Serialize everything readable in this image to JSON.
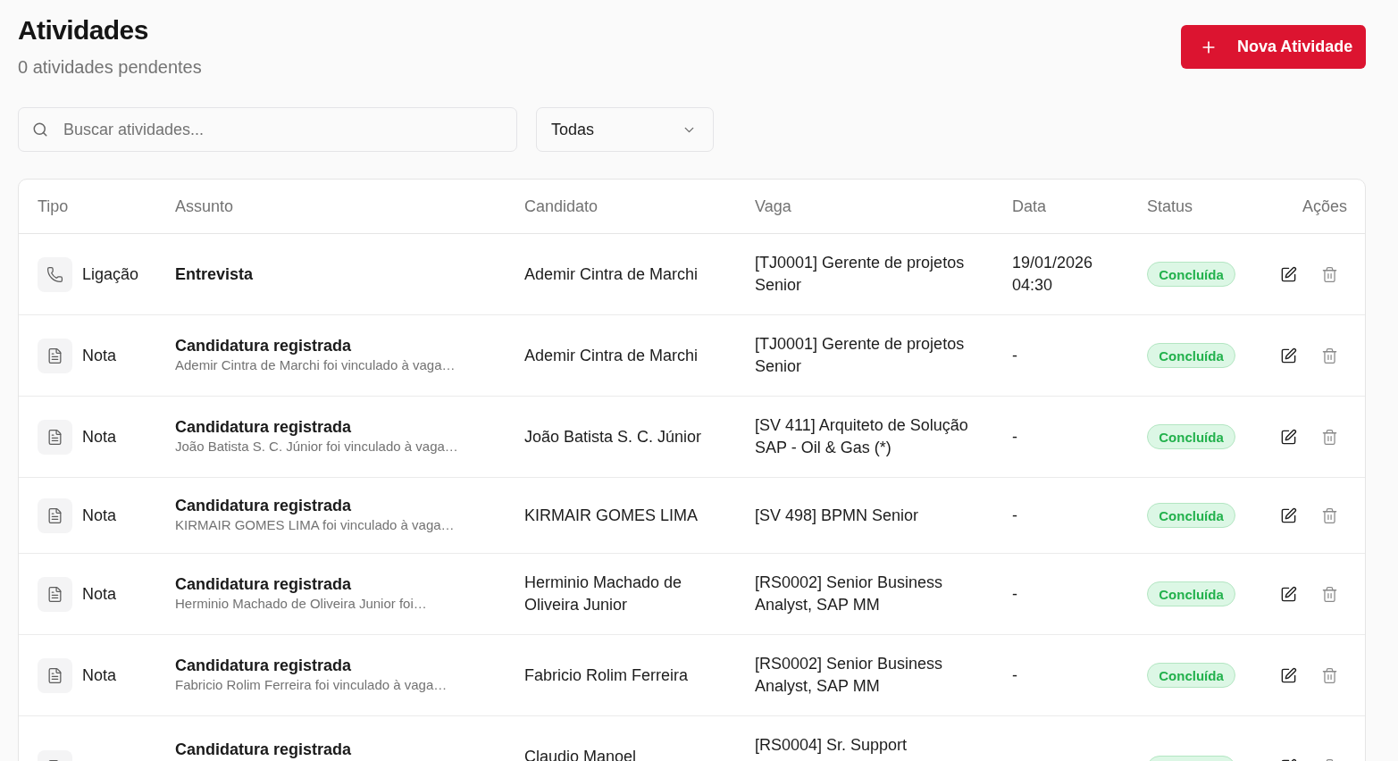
{
  "page": {
    "title": "Atividades",
    "subtitle": "0 atividades pendentes"
  },
  "new_button": {
    "label": "Nova Atividade"
  },
  "search": {
    "placeholder": "Buscar atividades..."
  },
  "filter": {
    "value": "Todas"
  },
  "table": {
    "columns": [
      "Tipo",
      "Assunto",
      "Candidato",
      "Vaga",
      "Data",
      "Status",
      "Ações"
    ],
    "rows": [
      {
        "type": {
          "kind": "call",
          "label": "Ligação"
        },
        "subject": "Entrevista",
        "candidate": "Ademir Cintra de Marchi",
        "job": "[TJ0001] Gerente de projetos Senior",
        "date": "19/01/2026 04:30",
        "status": {
          "kind": "done",
          "label": "Concluída"
        }
      },
      {
        "type": {
          "kind": "note",
          "label": "Nota"
        },
        "subject": "Candidatura registrada",
        "detail": "Ademir Cintra de Marchi foi vinculado à vaga…",
        "candidate": "Ademir Cintra de Marchi",
        "job": "[TJ0001] Gerente de projetos Senior",
        "date": "-",
        "status": {
          "kind": "done",
          "label": "Concluída"
        }
      },
      {
        "type": {
          "kind": "note",
          "label": "Nota"
        },
        "subject": "Candidatura registrada",
        "detail": "João Batista S. C. Júnior foi vinculado à vaga…",
        "candidate": "João Batista S. C. Júnior",
        "job": "[SV 411] Arquiteto de Solução SAP - Oil & Gas (*)",
        "date": "-",
        "status": {
          "kind": "done",
          "label": "Concluída"
        }
      },
      {
        "type": {
          "kind": "note",
          "label": "Nota"
        },
        "subject": "Candidatura registrada",
        "detail": "KIRMAIR GOMES LIMA foi vinculado à vaga…",
        "candidate": "KIRMAIR GOMES LIMA",
        "job": "[SV 498] BPMN Senior",
        "date": "-",
        "status": {
          "kind": "done",
          "label": "Concluída"
        }
      },
      {
        "type": {
          "kind": "note",
          "label": "Nota"
        },
        "subject": "Candidatura registrada",
        "detail": "Herminio Machado de Oliveira Junior foi…",
        "candidate": "Herminio Machado de Oliveira Junior",
        "job": "[RS0002] Senior Business Analyst, SAP MM",
        "date": "-",
        "status": {
          "kind": "done",
          "label": "Concluída"
        }
      },
      {
        "type": {
          "kind": "note",
          "label": "Nota"
        },
        "subject": "Candidatura registrada",
        "detail": "Fabricio Rolim Ferreira foi vinculado à vaga…",
        "candidate": "Fabricio Rolim Ferreira",
        "job": "[RS0002] Senior Business Analyst, SAP MM",
        "date": "-",
        "status": {
          "kind": "done",
          "label": "Concluída"
        }
      },
      {
        "type": {
          "kind": "note"
        },
        "subject": "Candidatura registrada",
        "candidate": "Claudio Manoel",
        "job": "[RS0004] Sr. Support",
        "status": {
          "kind": "done"
        }
      }
    ]
  }
}
